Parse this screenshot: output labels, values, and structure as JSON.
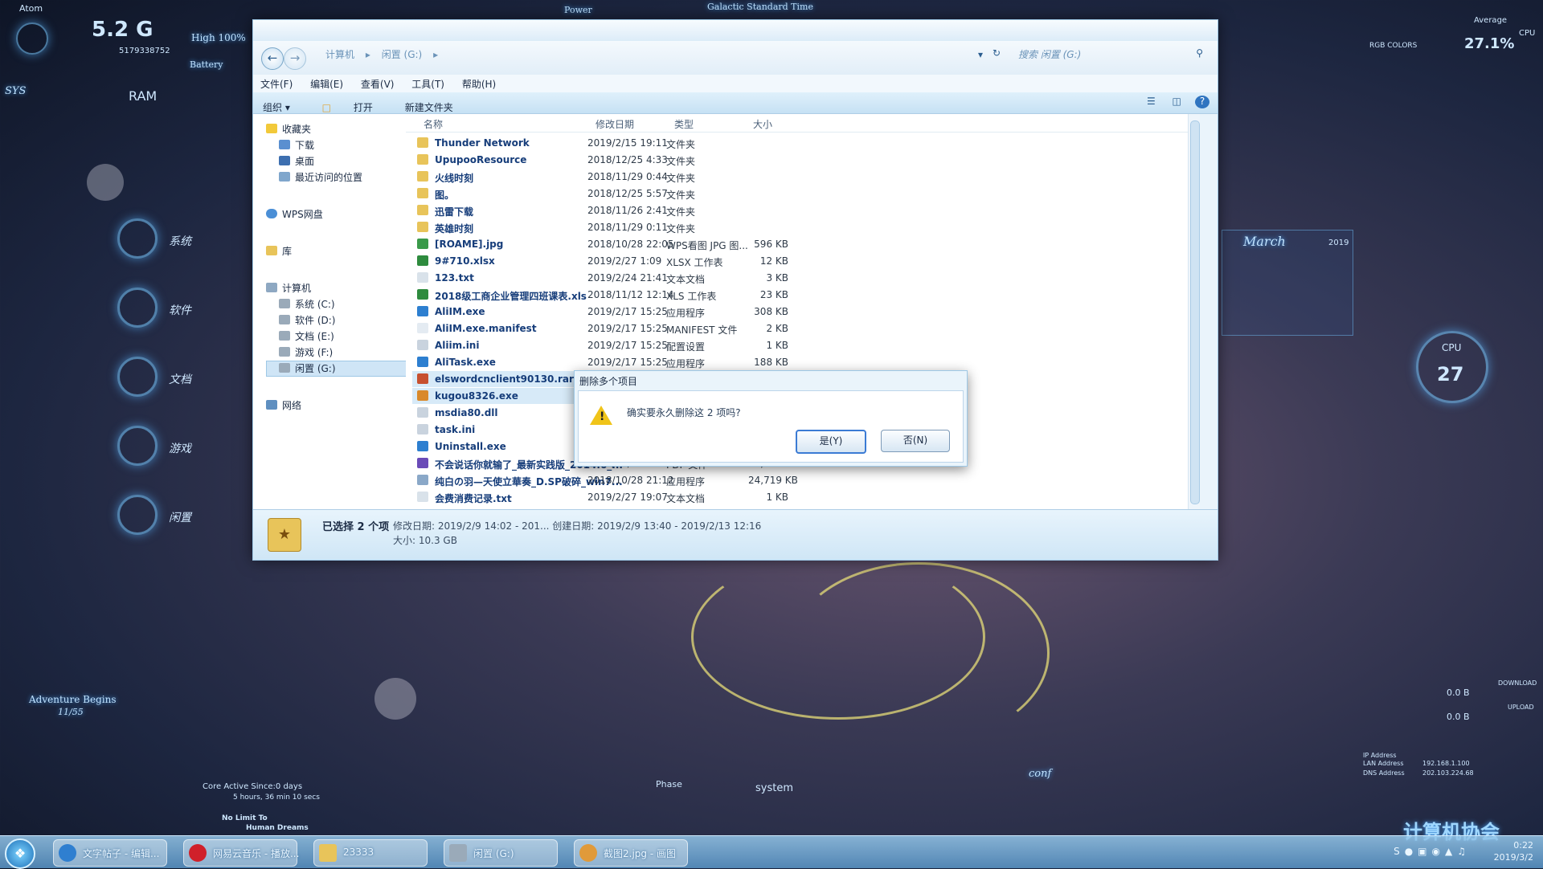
{
  "desktop": {
    "atom_label": "Atom",
    "ram_value": "5.2 G",
    "ram_sub": "5179338752",
    "ram_label": "RAM",
    "battery_high": "High 100%",
    "battery_label": "Battery",
    "sys_label": "SYS",
    "power_label": "Power",
    "galactic_label": "Galactic Standard Time",
    "side_items": [
      "系统",
      "软件",
      "文档",
      "游戏",
      "闲置"
    ],
    "cpu_average_label": "Average",
    "cpu_label": "CPU",
    "cpu_average_value": "27.1%",
    "rgb_label": "RGB COLORS",
    "calendar_month": "March",
    "calendar_year": "2019",
    "cpu_gauge_label": "CPU",
    "cpu_gauge_value": "27",
    "adventure_label": "Adventure Begins",
    "adventure_time": "11/55",
    "core_active": "Core Active Since:0 days",
    "uptime": "5 hours, 36 min 10 secs",
    "no_limit": "No Limit To",
    "human_dreams": "Human Dreams",
    "phase_label": "Phase",
    "system_label": "system",
    "conf_label": "conf",
    "download_label": "DOWNLOAD",
    "upload_label": "UPLOAD",
    "download_value": "0.0 B",
    "upload_value": "0.0 B",
    "ip_address_label": "IP Address",
    "lan_label": "LAN Address",
    "dns_label": "DNS Address",
    "lan_value": "192.168.1.100",
    "dns_value": "202.103.224.68",
    "watermark": "计算机协会"
  },
  "explorer": {
    "address": [
      "计算机",
      "闲置 (G:)"
    ],
    "search_placeholder": "搜索 闲置 (G:)",
    "menu": [
      "文件(F)",
      "编辑(E)",
      "查看(V)",
      "工具(T)",
      "帮助(H)"
    ],
    "toolbar": {
      "organize": "组织 ▾",
      "open": "打开",
      "new_folder": "新建文件夹"
    },
    "nav": {
      "favorites": "收藏夹",
      "downloads": "下载",
      "desktop": "桌面",
      "recent": "最近访问的位置",
      "wps": "WPS网盘",
      "libraries": "库",
      "computer": "计算机",
      "drive_c": "系统 (C:)",
      "drive_d": "软件 (D:)",
      "drive_e": "文档 (E:)",
      "drive_f": "游戏 (F:)",
      "drive_g": "闲置 (G:)",
      "network": "网络"
    },
    "columns": {
      "name": "名称",
      "date": "修改日期",
      "type": "类型",
      "size": "大小"
    },
    "files": [
      {
        "name": "Thunder Network",
        "date": "2019/2/15 19:11",
        "type": "文件夹",
        "size": "",
        "color": "#e8c45a"
      },
      {
        "name": "UpupooResource",
        "date": "2018/12/25 4:33",
        "type": "文件夹",
        "size": "",
        "color": "#e8c45a"
      },
      {
        "name": "火线时刻",
        "date": "2018/11/29 0:44",
        "type": "文件夹",
        "size": "",
        "color": "#e8c45a"
      },
      {
        "name": "图。",
        "date": "2018/12/25 5:57",
        "type": "文件夹",
        "size": "",
        "color": "#e8c45a"
      },
      {
        "name": "迅雷下载",
        "date": "2018/11/26 2:41",
        "type": "文件夹",
        "size": "",
        "color": "#e8c45a"
      },
      {
        "name": "英雄时刻",
        "date": "2018/11/29 0:11",
        "type": "文件夹",
        "size": "",
        "color": "#e8c45a"
      },
      {
        "name": "[ROAME].jpg",
        "date": "2018/10/28 22:05",
        "type": "WPS看图 JPG 图...",
        "size": "596 KB",
        "color": "#3a9a4a"
      },
      {
        "name": "9#710.xlsx",
        "date": "2019/2/27 1:09",
        "type": "XLSX 工作表",
        "size": "12 KB",
        "color": "#2e8b3e"
      },
      {
        "name": "123.txt",
        "date": "2019/2/24 21:41",
        "type": "文本文档",
        "size": "3 KB",
        "color": "#d9e2ea"
      },
      {
        "name": "2018级工商企业管理四班课表.xls",
        "date": "2018/11/12 12:14",
        "type": "XLS 工作表",
        "size": "23 KB",
        "color": "#2e8b3e"
      },
      {
        "name": "AliIM.exe",
        "date": "2019/2/17 15:25",
        "type": "应用程序",
        "size": "308 KB",
        "color": "#2d7fd0"
      },
      {
        "name": "AliIM.exe.manifest",
        "date": "2019/2/17 15:25",
        "type": "MANIFEST 文件",
        "size": "2 KB",
        "color": "#e4ebf2"
      },
      {
        "name": "Aliim.ini",
        "date": "2019/2/17 15:25",
        "type": "配置设置",
        "size": "1 KB",
        "color": "#c9d3de"
      },
      {
        "name": "AliTask.exe",
        "date": "2019/2/17 15:25",
        "type": "应用程序",
        "size": "188 KB",
        "color": "#2d7fd0"
      },
      {
        "name": "elswordcnclient90130.rar",
        "date": "",
        "type": "",
        "size": "",
        "color": "#c7502f"
      },
      {
        "name": "kugou8326.exe",
        "date": "",
        "type": "",
        "size": "",
        "color": "#d9892b"
      },
      {
        "name": "msdia80.dll",
        "date": "",
        "type": "",
        "size": "",
        "color": "#c9d3de"
      },
      {
        "name": "task.ini",
        "date": "",
        "type": "",
        "size": "",
        "color": "#c9d3de"
      },
      {
        "name": "Uninstall.exe",
        "date": "",
        "type": "",
        "size": "",
        "color": "#2d7fd0"
      },
      {
        "name": "不会说话你就输了_最新实践版_2014.6_...",
        "date": "2018/11/6 0:20",
        "type": "PDF 文件",
        "size": "30,154 KB",
        "color": "#6a4bb8"
      },
      {
        "name": "纯白の羽—天使立華奏_D.SP破碎_win7...",
        "date": "2018/10/28 21:12",
        "type": "应用程序",
        "size": "24,719 KB",
        "color": "#8aa8c8"
      },
      {
        "name": "会费消费记录.txt",
        "date": "2019/2/27 19:07",
        "type": "文本文档",
        "size": "1 KB",
        "color": "#d9e2ea"
      }
    ],
    "details": {
      "title": "已选择 2 个项",
      "meta": "修改日期: 2019/2/9 14:02 - 201...   创建日期: 2019/2/9 13:40 - 2019/2/13 12:16",
      "size": "大小: 10.3 GB"
    }
  },
  "dialog": {
    "title": "删除多个项目",
    "message": "确实要永久删除这 2 项吗?",
    "yes": "是(Y)",
    "no": "否(N)"
  },
  "taskbar": {
    "tasks": [
      "文字帖子 - 编辑...",
      "网易云音乐 - 播放...",
      "23333",
      "闲置 (G:)",
      "截图2.jpg - 画图"
    ],
    "clock_time": "0:22",
    "clock_date": "2019/3/2"
  }
}
